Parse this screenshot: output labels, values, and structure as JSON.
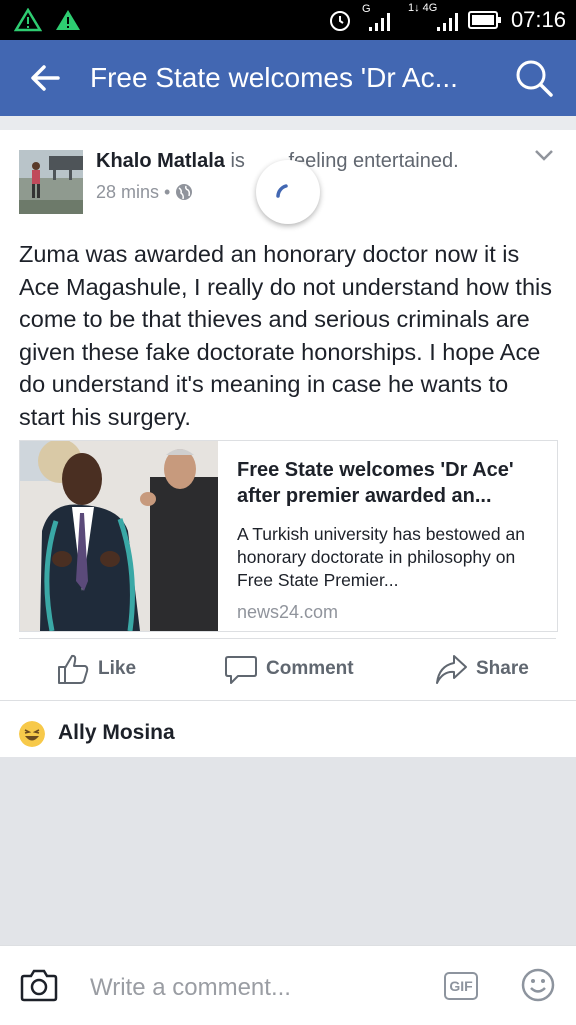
{
  "status_bar": {
    "warning_icon": "warning-triangle-icon",
    "network_labels": [
      "G",
      "1↓ 4G",
      "4G"
    ],
    "time": "07:16"
  },
  "app_bar": {
    "title": "Free State welcomes 'Dr Ac...",
    "back_icon": "arrow-left-icon",
    "search_icon": "search-icon"
  },
  "post": {
    "author": "Khalo Matlala",
    "activity_prefix": "is",
    "activity_suffix": "feeling entertained.",
    "time_ago": "28 mins",
    "separator": "•",
    "privacy_icon": "globe-icon",
    "body": "Zuma was awarded an honorary doctor now it is Ace Magashule, I really do not understand how this come to be that thieves and serious criminals are given these fake doctorate honorships. I hope Ace do understand it's meaning in case he wants to start his surgery.",
    "link": {
      "title": "Free State welcomes 'Dr Ace' after premier awarded an...",
      "description": "A Turkish university has bestowed an honorary doctorate in philosophy on Free State Premier...",
      "source": "news24.com"
    },
    "actions": {
      "like": "Like",
      "comment": "Comment",
      "share": "Share"
    }
  },
  "reaction": {
    "emoji": "laughing-emoji-icon",
    "name": "Ally Mosina"
  },
  "composer": {
    "placeholder": "Write a comment...",
    "gif_label": "GIF"
  },
  "colors": {
    "brand": "#4267b2",
    "text": "#1d2129",
    "muted": "#90949c"
  }
}
